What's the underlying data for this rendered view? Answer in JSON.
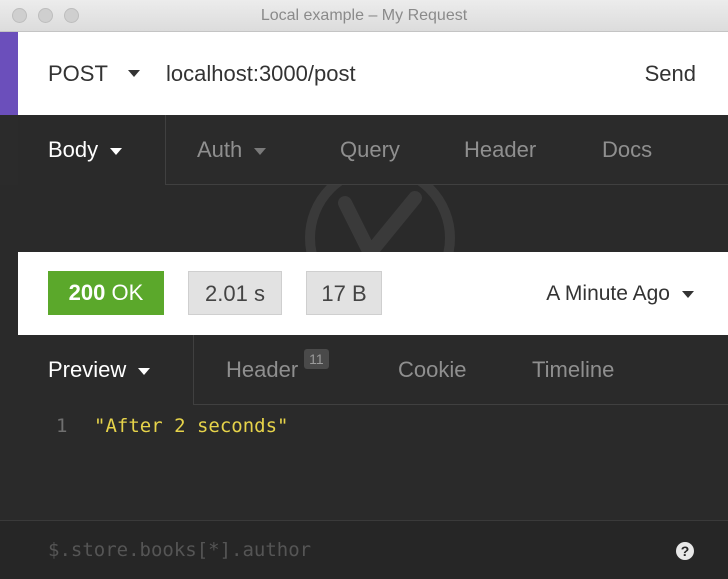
{
  "window": {
    "title": "Local example – My Request"
  },
  "request": {
    "method": "POST",
    "url": "localhost:3000/post",
    "send_label": "Send",
    "tabs": [
      {
        "label": "Body"
      },
      {
        "label": "Auth"
      },
      {
        "label": "Query"
      },
      {
        "label": "Header"
      },
      {
        "label": "Docs"
      }
    ]
  },
  "response": {
    "status_code": "200",
    "status_text": "OK",
    "time": "2.01 s",
    "size": "17 B",
    "received": "A Minute Ago",
    "tabs": [
      {
        "label": "Preview"
      },
      {
        "label": "Header",
        "badge": "11"
      },
      {
        "label": "Cookie"
      },
      {
        "label": "Timeline"
      }
    ],
    "preview": {
      "line_number": "1",
      "content": "\"After 2 seconds\""
    }
  },
  "filter": {
    "placeholder": "$.store.books[*].author"
  },
  "help": {
    "label": "?"
  },
  "colors": {
    "accent": "#6b4fbb",
    "status_ok": "#5ba82b",
    "code": "#e6d34a"
  },
  "icons": [
    "chevron-down-icon",
    "help-circle-icon",
    "logo-watermark-icon"
  ]
}
